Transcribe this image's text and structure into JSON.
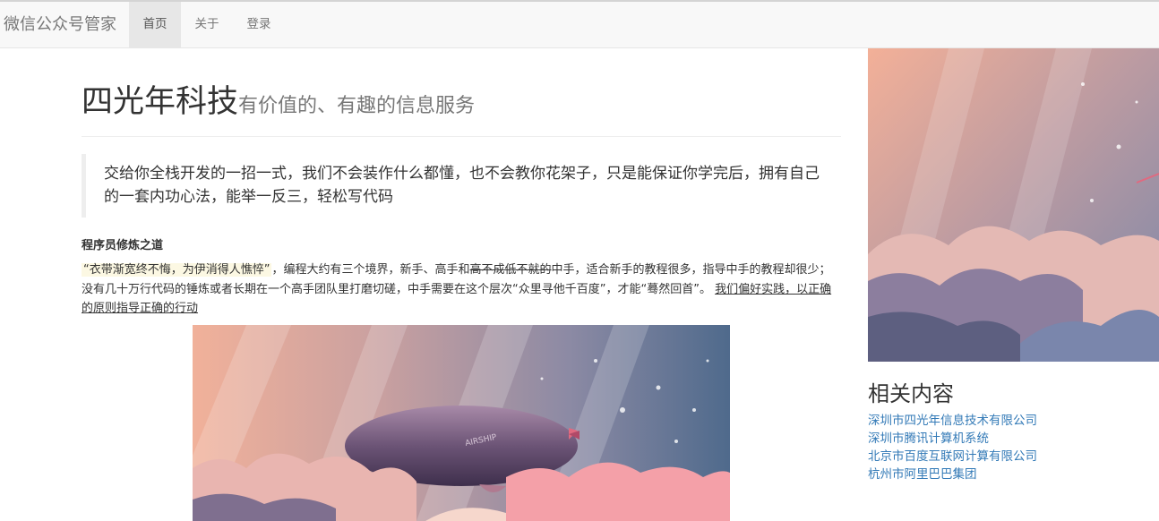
{
  "navbar": {
    "brand": "微信公众号管家",
    "items": [
      {
        "label": "首页",
        "active": true
      },
      {
        "label": "关于",
        "active": false
      },
      {
        "label": "登录",
        "active": false
      }
    ]
  },
  "header": {
    "title": "四光年科技",
    "subtitle": "有价值的、有趣的信息服务"
  },
  "blockquote": "交给你全栈开发的一招一式，我们不会装作什么都懂，也不会教你花架子，只是能保证你学完后，拥有自己的一套内功心法，能举一反三，轻松写代码",
  "section_title": "程序员修炼之道",
  "paragraph": {
    "highlight": "“衣带渐宽终不悔，为伊消得人憔悴”",
    "text1": "，编程大约有三个境界，新手、高手和",
    "strike": "高不成低不就的",
    "text2": "中手，适合新手的教程很多，指导中手的教程却很少；没有几十万行代码的锤炼或者长期在一个高手团队里打磨切磋，中手需要在这个层次“众里寻他千百度”，才能“蓦然回首”。",
    "underline": "我们偏好实践，以正确的原则指导正确的行动"
  },
  "airship_label": "AIRSHIP",
  "related": {
    "title": "相关内容",
    "links": [
      "深圳市四光年信息技术有限公司",
      "深圳市腾讯计算机系统",
      "北京市百度互联网计算有限公司",
      "杭州市阿里巴巴集团"
    ]
  },
  "colors": {
    "link": "#337ab7",
    "nav_bg": "#f8f8f8",
    "highlight_bg": "#fcf8e3"
  }
}
